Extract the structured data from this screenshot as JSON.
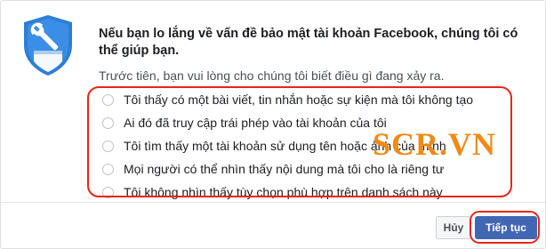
{
  "headline": "Nếu bạn lo lắng về vấn đề bảo mật tài khoản Facebook, chúng tôi có thể giúp bạn.",
  "subtitle": "Trước tiên, bạn vui lòng cho chúng tôi biết điều gì đang xảy ra.",
  "options": [
    "Tôi thấy có một bài viết, tin nhắn hoặc sự kiện mà tôi không tạo",
    "Ai đó đã truy cập trái phép vào tài khoản của tôi",
    "Tôi tìm thấy một tài khoản sử dụng tên hoặc ảnh của mình",
    "Mọi người có thể nhìn thấy nội dung mà tôi cho là riêng tư",
    "Tôi không nhìn thấy tùy chọn phù hợp trên danh sách này"
  ],
  "buttons": {
    "cancel": "Hủy",
    "next": "Tiếp tục"
  },
  "watermark": "SCR.VN",
  "colors": {
    "shield": "#2d7fd6",
    "primary": "#4267b2",
    "highlight": "#e8261b",
    "watermark": "#f08a14"
  },
  "icons": {
    "shield": "shield-wrench-icon",
    "radio": "radio-unchecked-icon"
  }
}
